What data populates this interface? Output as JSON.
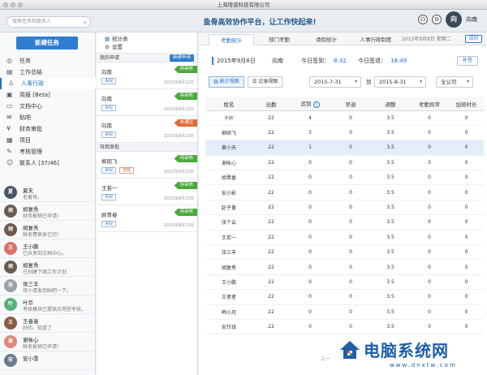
{
  "window": {
    "title": "上海增道科技有限公司"
  },
  "header": {
    "search_placeholder": "搜索任务和联系人",
    "slogan": "鱼骨高效协作平台，让工作快起来!",
    "user_name": "向南",
    "user_avatar_text": "向"
  },
  "sidebar": {
    "new_task_label": "新建任务",
    "nav": [
      {
        "label": "任务",
        "icon": "target-icon"
      },
      {
        "label": "工作总结",
        "icon": "document-icon"
      },
      {
        "label": "人事行政",
        "icon": "person-icon"
      },
      {
        "label": "简报 [Beta]",
        "icon": "report-icon"
      },
      {
        "label": "文档中心",
        "icon": "folder-icon"
      },
      {
        "label": "贴吧",
        "icon": "chat-icon"
      },
      {
        "label": "财务审批",
        "icon": "money-icon"
      },
      {
        "label": "项目",
        "icon": "project-icon"
      },
      {
        "label": "考核管理",
        "icon": "assessment-icon"
      },
      {
        "label": "联系人 [37/46]",
        "icon": "contacts-icon"
      }
    ],
    "contacts": [
      {
        "name": "夏夫",
        "msg": "老着快。",
        "avatar": "夏",
        "color": "#4a5566"
      },
      {
        "name": "胡复秀",
        "msg": "财务报销已申请!",
        "avatar": "胡",
        "color": "#6d5a4c"
      },
      {
        "name": "胡复秀",
        "msg": "财务费宿舍已完！",
        "avatar": "胡",
        "color": "#6d5a4c"
      },
      {
        "name": "王小鹏",
        "msg": "已共享到文档中心。",
        "avatar": "王",
        "color": "#d9726a"
      },
      {
        "name": "胡复秀",
        "msg": "已创建下周工作计划",
        "avatar": "胡",
        "color": "#6d5a4c"
      },
      {
        "name": "张三丰",
        "msg": "待小请发到贴吧一下。",
        "avatar": "张",
        "color": "#9aa0a6"
      },
      {
        "name": "叶华",
        "msg": "考核模块已提供应用型考核。",
        "avatar": "叶",
        "color": "#57b07a"
      },
      {
        "name": "王者者",
        "msg": "好的，知道了",
        "avatar": "王",
        "color": "#8a5a44"
      },
      {
        "name": "谢咏心",
        "msg": "财务报销已申请!",
        "avatar": "谢",
        "color": "#e0867b"
      },
      {
        "name": "安小雪",
        "msg": "",
        "avatar": "安",
        "color": "#6c7a89"
      }
    ]
  },
  "midpanel": {
    "stats_label": "统计表",
    "settings_label": "设置",
    "my_requests_label": "我的申请",
    "new_request_label": "新建申请",
    "my_requests": [
      {
        "name": "向南",
        "badge": "待审核",
        "badge_color": "green",
        "tag": "事假",
        "date": "2015年8月12日"
      },
      {
        "name": "向南",
        "badge": "待审核",
        "badge_color": "green",
        "tag": "事假",
        "date": "2015年8月13日"
      },
      {
        "name": "向南",
        "badge": "未通过",
        "badge_color": "red",
        "tag": "事假",
        "date": "2015年8月13日"
      }
    ],
    "pending_label": "待我审批",
    "pending": [
      {
        "name": "柳硕飞",
        "badge": "待审核",
        "badge_color": "green",
        "tag": "事假",
        "tag2": "加班",
        "date": "2015年8月13日"
      },
      {
        "name": "王若一",
        "badge": "待审核",
        "badge_color": "green",
        "tag": "事假",
        "tag2": "",
        "date": "2015年8月13日"
      },
      {
        "name": "顾青春",
        "badge": "待审核",
        "badge_color": "green",
        "tag": "事假",
        "tag2": "",
        "date": "2015年8月13日"
      }
    ]
  },
  "main": {
    "tabs": [
      "考勤统计",
      "部门考勤",
      "请假统计",
      "人事行政制度"
    ],
    "tab_date": "2015年9月8日  星期二",
    "today_btn": "回到",
    "info": {
      "date": "2015年9月8日",
      "name": "向南",
      "checkin_label": "今日签到：",
      "checkin_time": "8:32",
      "checkout_label": "今日签退：",
      "checkout_time": "18:49",
      "supplement_btn": "补签"
    },
    "toolbar": {
      "stats_view": "统计视图",
      "record_view": "记录视图",
      "from_date": "2015-7-31",
      "to_label": "到",
      "to_date": "2015-8-31",
      "company": "全公司"
    },
    "table": {
      "columns": [
        "姓名",
        "出勤",
        "迟到",
        "早退",
        "调整",
        "考勤异常",
        "加班时长"
      ],
      "rows": [
        [
          "千叶",
          "22",
          "4",
          "0",
          "3.5",
          "0",
          "0"
        ],
        [
          "柳硕飞",
          "22",
          "3",
          "0",
          "3.5",
          "0",
          "0"
        ],
        [
          "黄小天",
          "22",
          "1",
          "0",
          "3.5",
          "0",
          "0"
        ],
        [
          "谢咏心",
          "22",
          "0",
          "0",
          "3.5",
          "0",
          "0"
        ],
        [
          "胡晋香",
          "22",
          "0",
          "0",
          "3.5",
          "0",
          "0"
        ],
        [
          "安小影",
          "22",
          "0",
          "0",
          "3.5",
          "0",
          "0"
        ],
        [
          "赵子量",
          "22",
          "0",
          "0",
          "3.5",
          "0",
          "0"
        ],
        [
          "张个云",
          "22",
          "0",
          "0",
          "3.5",
          "0",
          "0"
        ],
        [
          "王若一",
          "22",
          "0",
          "0",
          "3.5",
          "0",
          "0"
        ],
        [
          "张三丰",
          "22",
          "0",
          "0",
          "3.5",
          "0",
          "0"
        ],
        [
          "胡复秀",
          "22",
          "0",
          "0",
          "3.5",
          "0",
          "0"
        ],
        [
          "王小鹏",
          "22",
          "0",
          "0",
          "3.5",
          "0",
          "0"
        ],
        [
          "王者者",
          "22",
          "0",
          "0",
          "3.5",
          "0",
          "0"
        ],
        [
          "韩小月",
          "22",
          "0",
          "0",
          "3.5",
          "0",
          "0"
        ],
        [
          "安玲珑",
          "22",
          "0",
          "0",
          "3.5",
          "0",
          "0"
        ]
      ],
      "selected_row": 2
    },
    "pager": "上一"
  },
  "watermark": {
    "text": "电脑系统网",
    "url": "www.dnxtw.com"
  },
  "colors": {
    "accent": "#2e7dd1",
    "green": "#49a93a",
    "red": "#e06a3b"
  }
}
